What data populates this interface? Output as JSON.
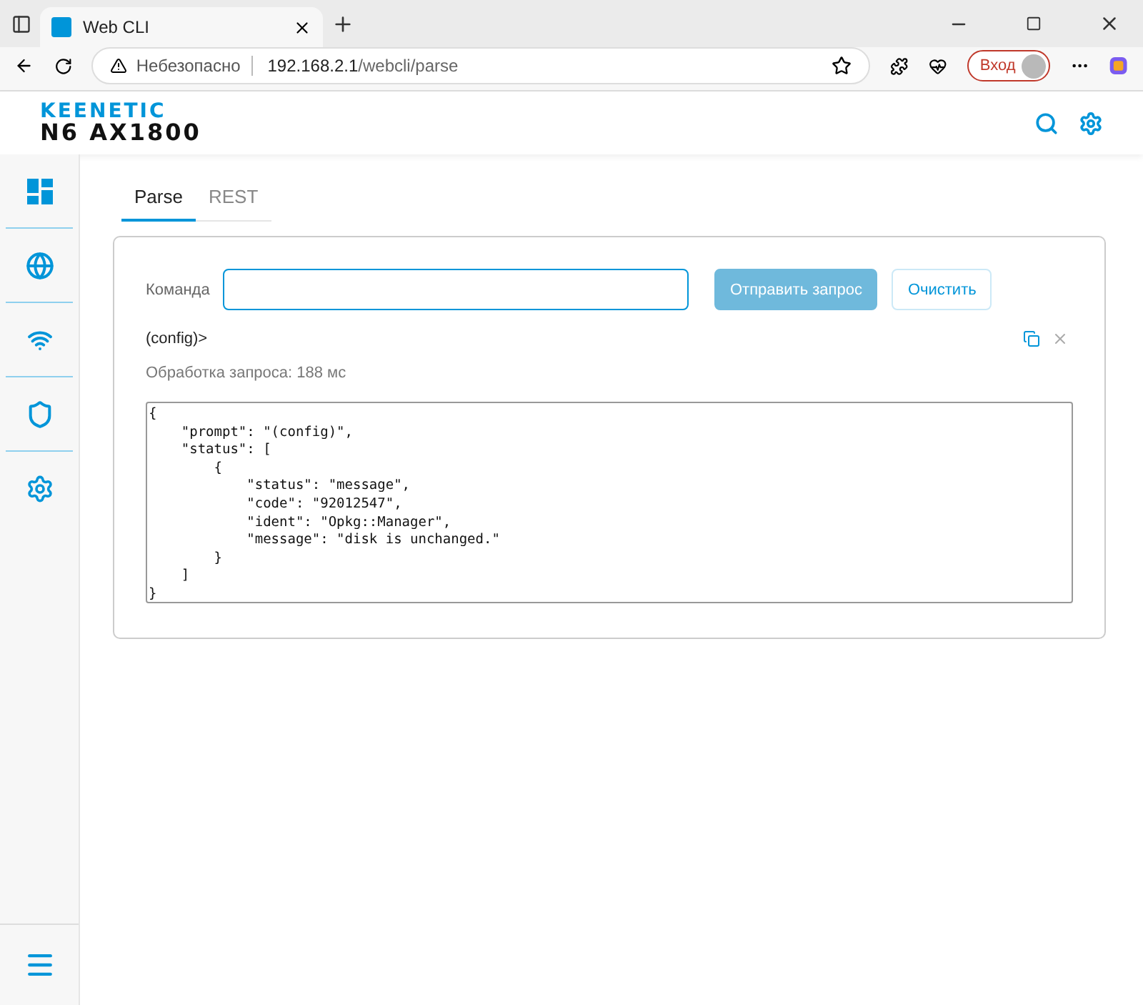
{
  "browser": {
    "tab": {
      "title": "Web CLI"
    },
    "address": {
      "security": "Небезопасно",
      "host": "192.168.2.1",
      "path": "/webcli/parse"
    },
    "sign_in": "Вход"
  },
  "header": {
    "brand": "KEENETIC",
    "model": "N6 AX1800"
  },
  "sidebar": {
    "items": [
      {
        "kind": "dashboard"
      },
      {
        "kind": "internet"
      },
      {
        "kind": "wifi"
      },
      {
        "kind": "security"
      },
      {
        "kind": "settings"
      }
    ]
  },
  "tabs": [
    {
      "label": "Parse",
      "selected": true
    },
    {
      "label": "REST",
      "selected": false
    }
  ],
  "command": {
    "label": "Команда"
  },
  "buttons": [
    {
      "label": "Отправить запрос",
      "disabled": true
    },
    {
      "label": "Очистить",
      "disabled": false
    }
  ],
  "prompt": "(config)>",
  "timing": "Обработка запроса: 188 мс",
  "output": "{\n    \"prompt\": \"(config)\",\n    \"status\": [\n        {\n            \"status\": \"message\",\n            \"code\": \"92012547\",\n            \"ident\": \"Opkg::Manager\",\n            \"message\": \"disk is unchanged.\"\n        }\n    ]\n}"
}
